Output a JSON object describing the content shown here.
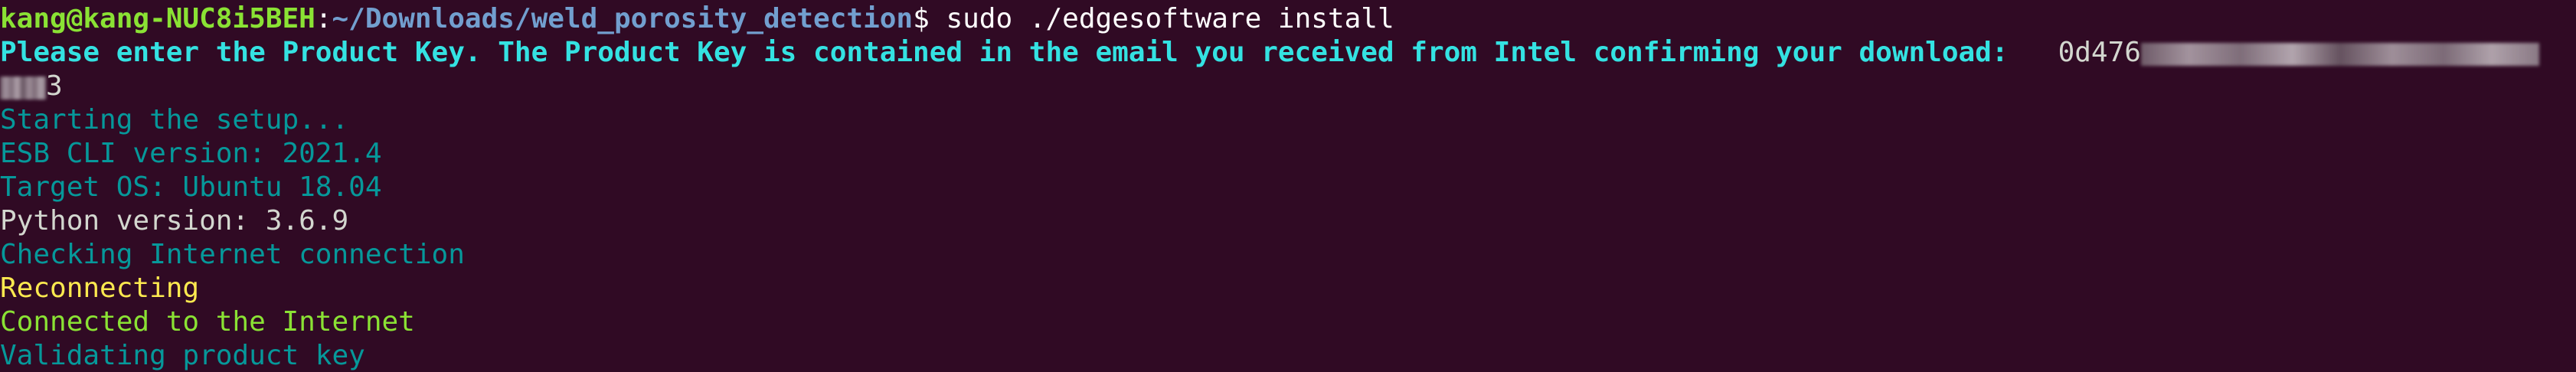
{
  "terminal": {
    "prompt": {
      "user_host": "kang@kang-NUC8i5BEH",
      "colon": ":",
      "path": "~/Downloads/weld_porosity_detection",
      "symbol": "$",
      "command": " sudo ./edgesoftware install"
    },
    "product_key_prompt": "Please enter the Product Key. The Product Key is contained in the email you received from Intel confirming your download: ",
    "product_key_visible_start": "  0d476",
    "product_key_visible_end": "3",
    "lines": [
      {
        "text": "Starting the setup...",
        "color": "cyan"
      },
      {
        "text": "ESB CLI version: 2021.4",
        "color": "cyan"
      },
      {
        "text": "Target OS: Ubuntu 18.04",
        "color": "cyan"
      },
      {
        "text": "Python version: 3.6.9",
        "color": "white"
      },
      {
        "text": "Checking Internet connection",
        "color": "cyan"
      },
      {
        "text": "Reconnecting",
        "color": "yellow"
      },
      {
        "text": "Connected to the Internet",
        "color": "green"
      },
      {
        "text": "Validating product key",
        "color": "cyan"
      }
    ],
    "colors": {
      "background": "#300a24",
      "user_host": "#8ae234",
      "path": "#729fcf",
      "cyan_bold": "#34e2e2",
      "cyan": "#06989a",
      "white": "#d3d7cf",
      "yellow": "#fce94f",
      "green": "#8ae234"
    }
  }
}
